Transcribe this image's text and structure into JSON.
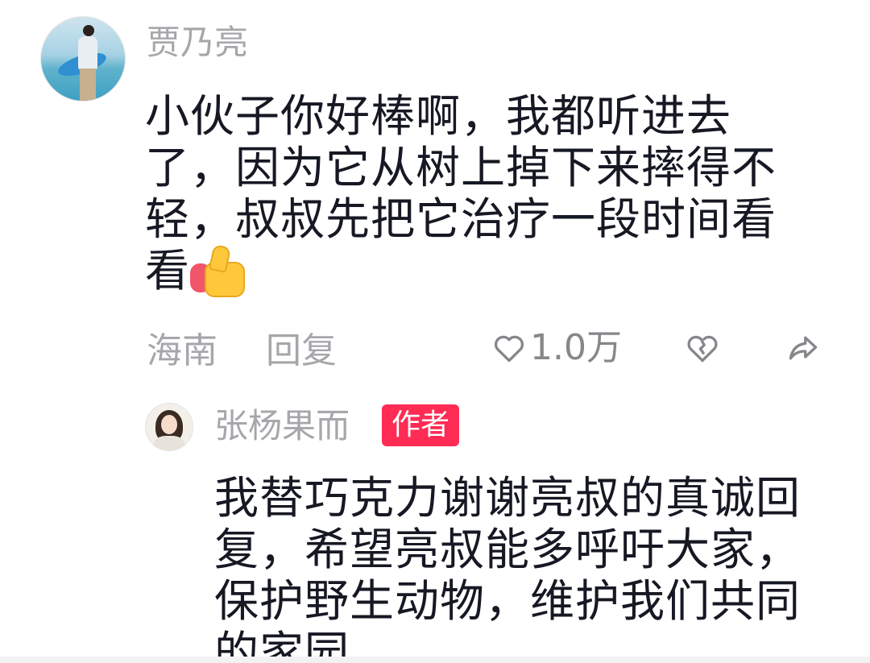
{
  "comment": {
    "username": "贾乃亮",
    "lines": [
      "小伙子你好棒啊，我都听进去",
      "了，因为它从树上掉下来摔得不",
      "轻，叔叔先把它治疗一段时间看",
      "看"
    ],
    "emoji": "thumbs-up",
    "location": "海南",
    "reply_label": "回复",
    "like_count": "1.0万"
  },
  "reply": {
    "username": "张杨果而",
    "badge": "作者",
    "lines": [
      "我替巧克力谢谢亮叔的真诚回",
      "复，希望亮叔能多呼吁大家，",
      "保护野生动物，维护我们共同",
      "的家园"
    ]
  },
  "colors": {
    "text": "#161823",
    "muted": "#a6a6ab",
    "badge": "#fe2c55"
  },
  "icons": {
    "like": "heart-outline-icon",
    "dislike": "broken-heart-icon",
    "share": "share-arrow-icon"
  }
}
